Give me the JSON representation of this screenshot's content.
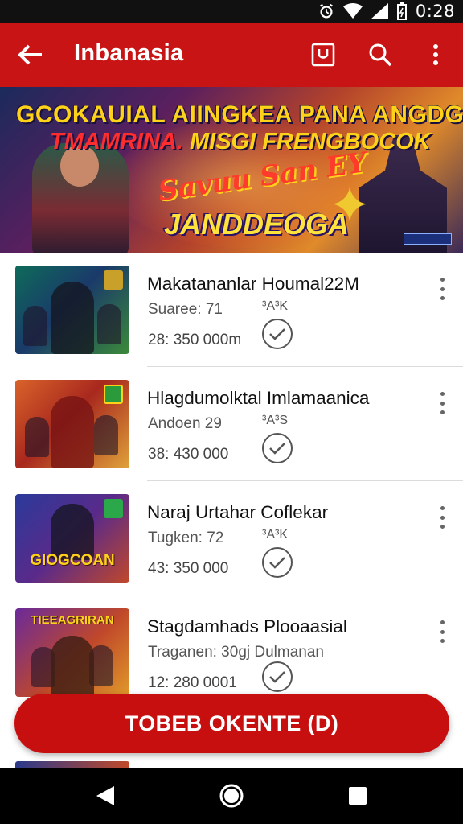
{
  "status_bar": {
    "time": "0:28",
    "icons": [
      "alarm-icon",
      "wifi-icon",
      "signal-icon",
      "battery-icon"
    ]
  },
  "app_bar": {
    "title": "Inbanasia",
    "actions": [
      "bookmark-icon",
      "search-icon",
      "more-vert-icon"
    ],
    "background": "#c81414"
  },
  "banner": {
    "line1": "GCOKAUIAL AIINGKEA PANA ANGDGIN",
    "line2_red": "TMAMRINA.",
    "line2_yellow": "MISGI FRENGBOCOK",
    "logo_top": "Savuu San EY",
    "logo_main": "JANDDEOGA"
  },
  "items": [
    {
      "title": "Makatananlar Houmal22M",
      "subtitle": "Suaree: 71",
      "small": "³A³K",
      "amount": "28: 350 000m"
    },
    {
      "title": "Hlagdumolktal Imlamaanica",
      "subtitle": "Andoen 29",
      "small": "³A³S",
      "amount": "38: 430 000"
    },
    {
      "title": "Naraj Urtahar Coflekar",
      "subtitle": "Tugken: 72",
      "small": "³A³K",
      "amount": "43: 350 000"
    },
    {
      "title": "Stagdamhads Plooaasial",
      "subtitle": "Traganen: 30gj Dulmanan",
      "small": "",
      "amount": "12: 280 0001"
    }
  ],
  "thumb_captions": [
    "",
    "",
    "GIOGCOAN",
    "TIEEAGRIRAN"
  ],
  "cta": {
    "label": "TOBEB OKENTE (D)",
    "color": "#c80f0f"
  },
  "nav": [
    "back-icon",
    "home-icon",
    "recents-icon"
  ]
}
